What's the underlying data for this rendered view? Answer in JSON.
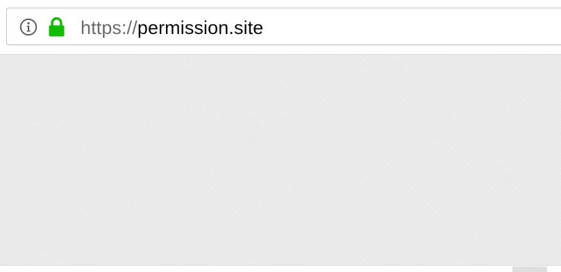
{
  "address_bar": {
    "scheme": "https://",
    "host": "permission.site"
  },
  "icons": {
    "info": "info-icon",
    "lock": "lock-icon"
  },
  "colors": {
    "lock_green": "#12bc00",
    "scheme_gray": "#6b6b6b",
    "host_text": "#0c0c0d",
    "content_background": "#e9e9e9"
  }
}
